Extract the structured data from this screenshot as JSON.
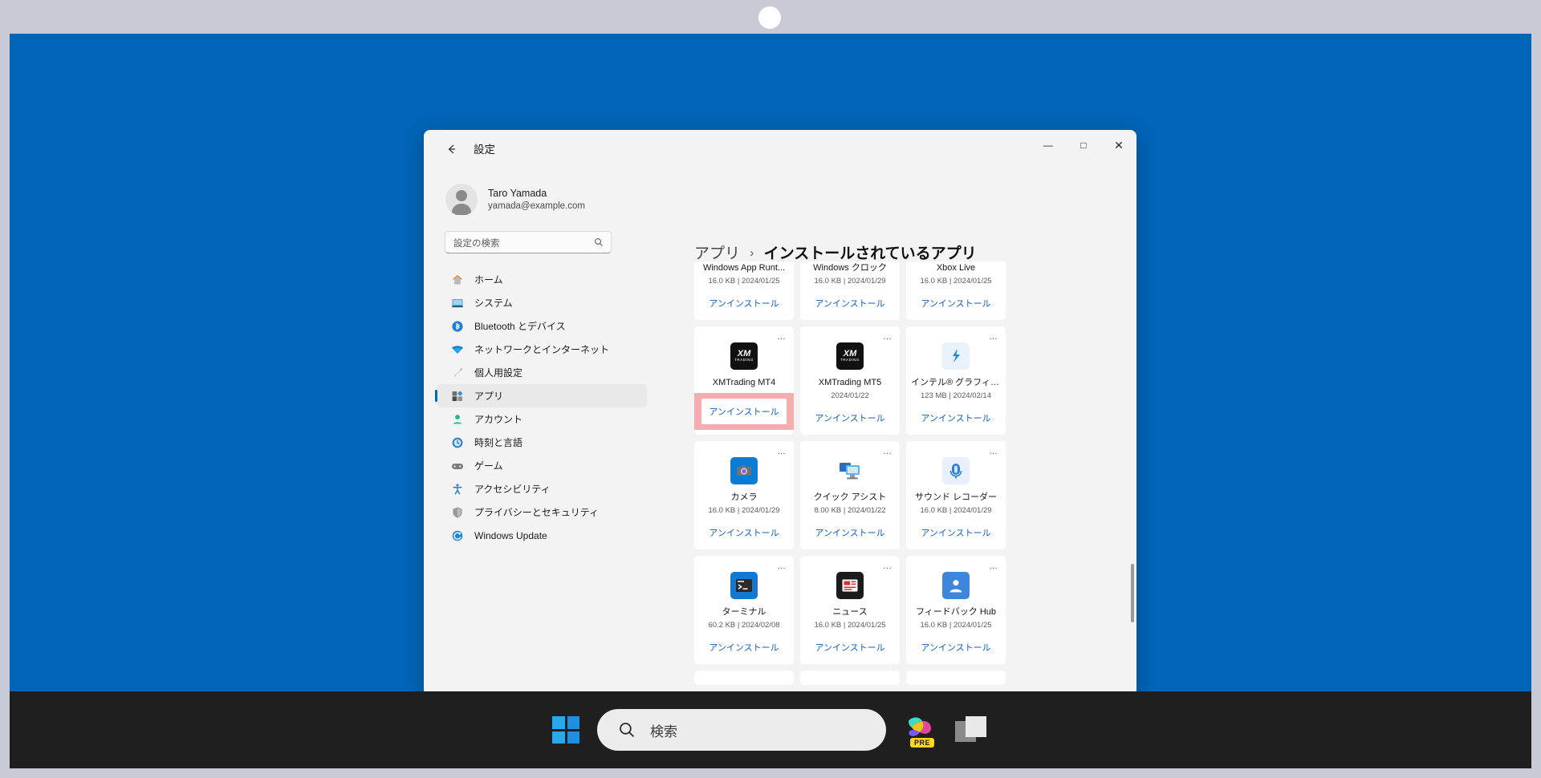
{
  "window": {
    "title": "設定",
    "back_icon": "back-arrow-icon",
    "minimize": "―",
    "maximize": "□",
    "close": "✕"
  },
  "account": {
    "name": "Taro Yamada",
    "email": "yamada@example.com"
  },
  "search": {
    "placeholder": "設定の検索",
    "icon": "search-icon"
  },
  "sidebar": {
    "items": [
      {
        "label": "ホーム",
        "icon": "home-icon",
        "selected": false
      },
      {
        "label": "システム",
        "icon": "system-icon",
        "selected": false
      },
      {
        "label": "Bluetooth とデバイス",
        "icon": "bluetooth-icon",
        "selected": false
      },
      {
        "label": "ネットワークとインターネット",
        "icon": "wifi-icon",
        "selected": false
      },
      {
        "label": "個人用設定",
        "icon": "personalization-brush-icon",
        "selected": false
      },
      {
        "label": "アプリ",
        "icon": "apps-icon",
        "selected": true
      },
      {
        "label": "アカウント",
        "icon": "account-person-icon",
        "selected": false
      },
      {
        "label": "時刻と言語",
        "icon": "clock-icon",
        "selected": false
      },
      {
        "label": "ゲーム",
        "icon": "gamepad-icon",
        "selected": false
      },
      {
        "label": "アクセシビリティ",
        "icon": "accessibility-icon",
        "selected": false
      },
      {
        "label": "プライバシーとセキュリティ",
        "icon": "shield-icon",
        "selected": false
      },
      {
        "label": "Windows Update",
        "icon": "update-icon",
        "selected": false
      }
    ]
  },
  "breadcrumb": {
    "parent": "アプリ",
    "separator": "›",
    "current": "インストールされているアプリ"
  },
  "uninstall_label": "アンインストール",
  "more_icon": "…",
  "apps": {
    "row_clipped": [
      {
        "name": "Windows App Runt...",
        "meta": "16.0 KB | 2024/01/25",
        "icon": "generic-app-icon"
      },
      {
        "name": "Windows クロック",
        "meta": "16.0 KB | 2024/01/29",
        "icon": "generic-app-icon"
      },
      {
        "name": "Xbox Live",
        "meta": "16.0 KB | 2024/01/25",
        "icon": "generic-app-icon"
      }
    ],
    "rows": [
      [
        {
          "name": "XMTrading MT4",
          "meta": "",
          "icon": "xmtrading-icon",
          "highlight": true
        },
        {
          "name": "XMTrading MT5",
          "meta": "2024/01/22",
          "icon": "xmtrading-icon",
          "highlight": false
        },
        {
          "name": "インテル® グラフィッ...",
          "meta": "123 MB | 2024/02/14",
          "icon": "intel-graphics-icon",
          "highlight": false
        }
      ],
      [
        {
          "name": "カメラ",
          "meta": "16.0 KB | 2024/01/29",
          "icon": "camera-icon",
          "highlight": false
        },
        {
          "name": "クイック アシスト",
          "meta": "8.00 KB | 2024/01/22",
          "icon": "quick-assist-icon",
          "highlight": false
        },
        {
          "name": "サウンド レコーダー",
          "meta": "16.0 KB | 2024/01/29",
          "icon": "sound-recorder-icon",
          "highlight": false
        }
      ],
      [
        {
          "name": "ターミナル",
          "meta": "60.2 KB | 2024/02/08",
          "icon": "terminal-icon",
          "highlight": false
        },
        {
          "name": "ニュース",
          "meta": "16.0 KB | 2024/01/25",
          "icon": "news-icon",
          "highlight": false
        },
        {
          "name": "フィードバック Hub",
          "meta": "16.0 KB | 2024/01/25",
          "icon": "feedback-hub-icon",
          "highlight": false
        }
      ]
    ]
  },
  "taskbar": {
    "start_icon": "windows-logo-icon",
    "search_placeholder": "検索",
    "search_icon": "search-icon",
    "copilot_icon": "copilot-icon",
    "copilot_badge": "PRE",
    "taskview_icon": "task-view-icon"
  },
  "colors": {
    "desktop": "#0065b8",
    "accent": "#0067c0",
    "link": "#0f5ec0",
    "highlight_pink": "#f7adad",
    "taskbar": "#1f1f1f",
    "bezel": "#c8cbd6"
  }
}
